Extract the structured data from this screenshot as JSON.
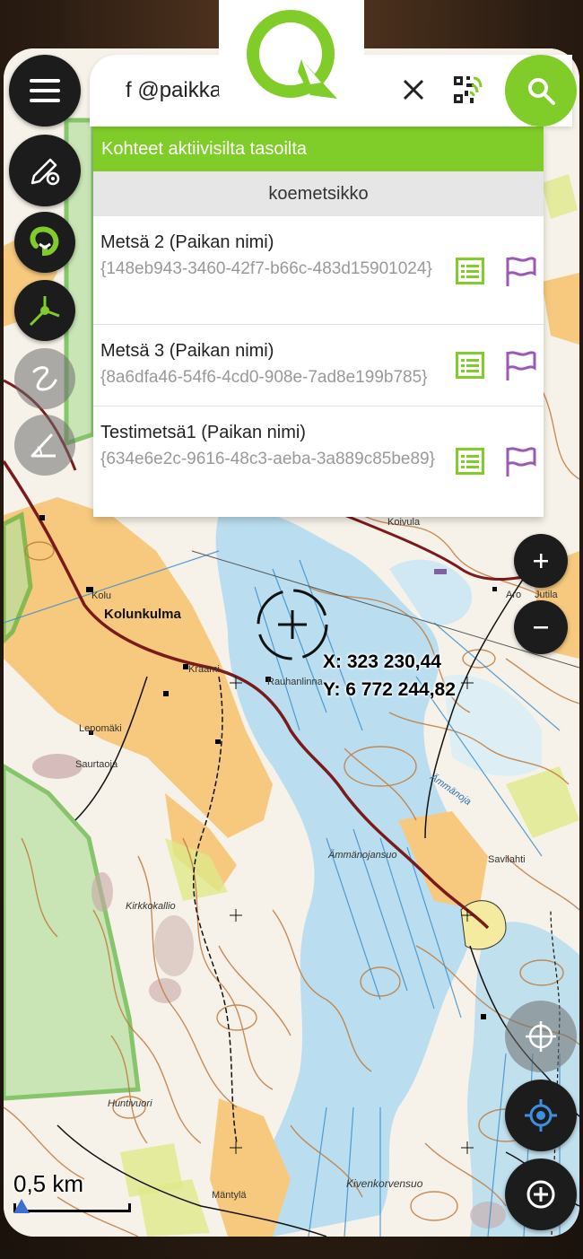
{
  "search": {
    "query": "f @paikka",
    "clear_icon": "close-icon",
    "qr_icon": "qr-scan-icon",
    "search_icon": "search-icon"
  },
  "results": {
    "header": "Kohteet aktiivisilta tasoilta",
    "group": "koemetsikko",
    "items": [
      {
        "title": "Metsä 2 (Paikan nimi)",
        "id": "{148eb943-3460-42f7-b66c-483d15901024}"
      },
      {
        "title": "Metsä 3 (Paikan nimi)",
        "id": "{8a6dfa46-54f6-4cd0-908e-7ad8e199b785}"
      },
      {
        "title": "Testimetsä1 (Paikan nimi)",
        "id": "{634e6e2c-9616-48c3-aeba-3a889c85be89}"
      }
    ]
  },
  "toolbar": {
    "menu_icon": "menu-icon",
    "digitize_icon": "edit-settings-icon",
    "snap_icon": "magnet-icon",
    "vertex_icon": "vertex-edit-icon",
    "freehand_icon": "freehand-icon",
    "measure_icon": "measure-angle-icon"
  },
  "map": {
    "x_coord": "X: 323 230,44",
    "y_coord": "Y: 6 772 244,82",
    "scale": "0,5 km",
    "places": {
      "kolunkulma": "Kolunkulma",
      "kolu": "Kolu",
      "kraami": "Kraami",
      "rauhanlinna": "Rauhanlinna",
      "lepomaki": "Lepomäki",
      "saurtaoja": "Saurtaoja",
      "ammanojansuo": "Ämmänojansuo",
      "savilahti": "Savilahti",
      "kirkkokallio": "Kirkkokallio",
      "huntivuori": "Huntivuori",
      "mantyla": "Mäntylä",
      "kivenkorvensuo": "Kivenkorvensuo",
      "koivula": "Koivula",
      "aro": "Aro",
      "jutila": "Jutila",
      "ammanoja": "Ämmänoja"
    }
  },
  "colors": {
    "accent": "#80cc28",
    "flag": "#9b59b6",
    "button": "#1c1c1c",
    "locate": "#3d8fe0"
  }
}
